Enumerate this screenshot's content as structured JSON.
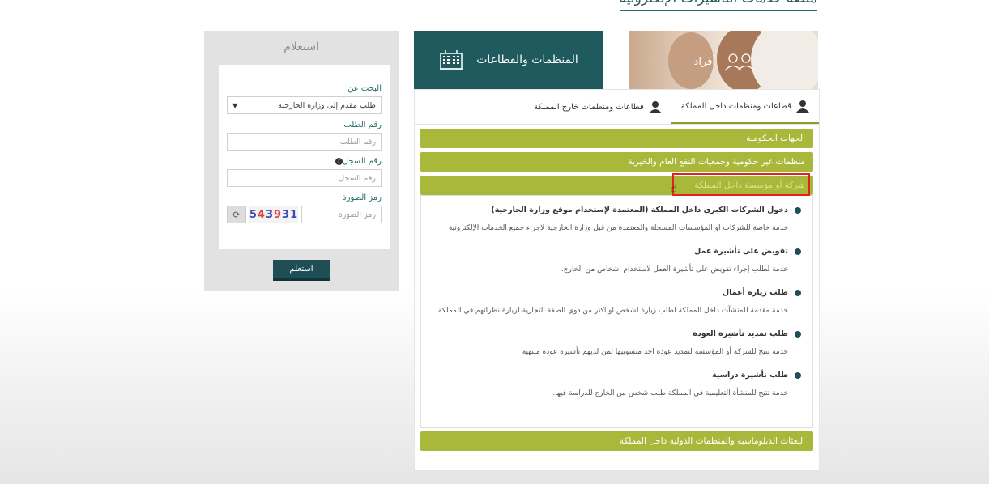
{
  "page": {
    "heading": "منصة خدمات التأشيرات الإلكترونية"
  },
  "inquiry": {
    "title": "استعلام",
    "search_label": "البحث عن",
    "search_value": "طلب مقدم إلى وزارة الخارجية",
    "request_label": "رقم الطلب",
    "request_placeholder": "رقم الطلب",
    "record_label": "رقم السجل",
    "record_placeholder": "رقم السجل",
    "captcha_label": "رمز الصورة",
    "captcha_placeholder": "رمز الصورة",
    "captcha_text": [
      "5",
      "4",
      "3",
      "9",
      "3",
      "1"
    ],
    "submit": "استعلم"
  },
  "tiles": {
    "organizations": "المنظمات والقطاعات",
    "individuals": "أفراد"
  },
  "tabs": [
    {
      "label": "قطاعات ومنظمات داخل المملكة",
      "active": true
    },
    {
      "label": "قطاعات ومنظمات خارج المملكة",
      "active": false
    }
  ],
  "accordion": {
    "gov": "الجهات الحكومية",
    "ngo": "منظمات غير حكومية وجمعيات النفع العام والخيرية",
    "company": "شركة أو مؤسسة داخل المملكة",
    "diplomatic": "البعثات الدبلوماسية والمنظمات الدولية داخل المملكة",
    "services": [
      {
        "title": "دخول الشركات الكبرى داخل المملكة (المعتمدة لإستخدام موقع وزارة الخارجية)",
        "desc": "خدمة خاصة للشركات او المؤسسات المسجلة والمعتمدة من قبل وزارة الخارجية لاجراء جميع الخدمات الإلكترونية"
      },
      {
        "title": "تفويض على تأشيرة عمل",
        "desc": "خدمة لطلب إجراء تفويض على تأشيرة العمل لاستخدام اشخاص من الخارج."
      },
      {
        "title": "طلب زيارة أعمال",
        "desc": "خدمة مقدمة للمنشآت داخل المملكة لطلب زيارة لشخص او اكثر من ذوي الصفة التجارية لزيارة نظرائهم في المملكة."
      },
      {
        "title": "طلب تمديد تأشيرة العودة",
        "desc": "خدمة تتيح للشركة أو المؤسسة لتمديد عودة احد منسوبيها لمن لديهم تأشيرة عودة منتهية"
      },
      {
        "title": "طلب تأشيرة دراسية",
        "desc": "خدمة تتيح للمنشأة التعليمية في المملكة طلب شخص من الخارج للدراسة فيها."
      }
    ]
  },
  "colors": {
    "teal": "#1f5a5e",
    "olive": "#a9b83a",
    "highlight": "#e0231b"
  }
}
